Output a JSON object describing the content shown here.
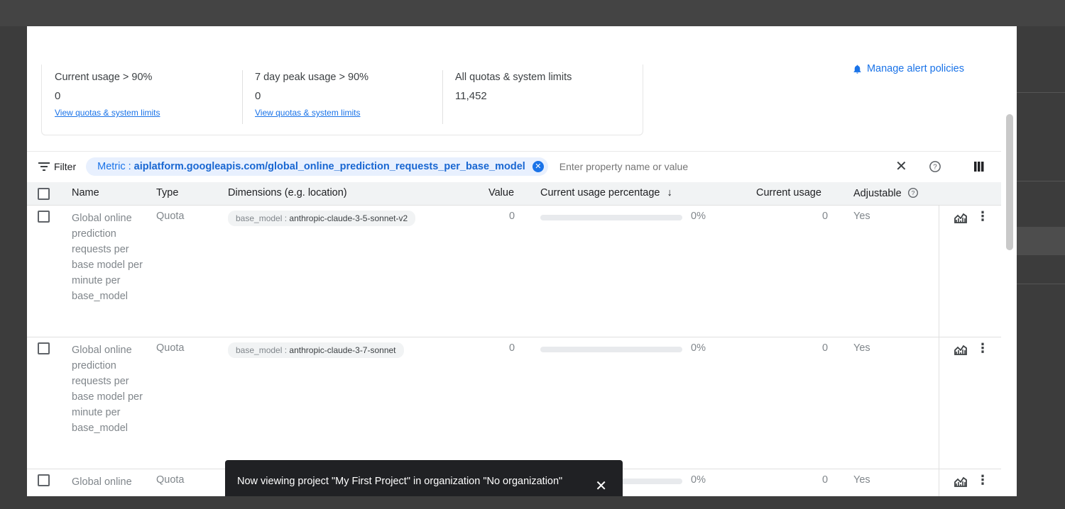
{
  "summary": {
    "stats": [
      {
        "label": "Current usage > 90%",
        "value": "0",
        "link": "View quotas & system limits"
      },
      {
        "label": "7 day peak usage > 90%",
        "value": "0",
        "link": "View quotas & system limits"
      },
      {
        "label": "All quotas & system limits",
        "value": "11,452"
      }
    ],
    "alert_link": "Manage alert policies"
  },
  "filter": {
    "label": "Filter",
    "chip_key": "Metric",
    "chip_sep": ":",
    "chip_value": "aiplatform.googleapis.com/global_online_prediction_requests_per_base_model",
    "placeholder": "Enter property name or value"
  },
  "table": {
    "headers": {
      "name": "Name",
      "type": "Type",
      "dimensions": "Dimensions (e.g. location)",
      "value": "Value",
      "usage_pct": "Current usage percentage",
      "current_usage": "Current usage",
      "adjustable": "Adjustable"
    },
    "rows": [
      {
        "name": "Global online prediction requests per base model per minute per base_model",
        "type": "Quota",
        "dim_key": "base_model",
        "dim_sep": ":",
        "dim_value": "anthropic-claude-3-5-sonnet-v2",
        "value": "0",
        "usage_pct": "0%",
        "usage_fraction": 0,
        "current_usage": "0",
        "adjustable": "Yes"
      },
      {
        "name": "Global online prediction requests per base model per minute per base_model",
        "type": "Quota",
        "dim_key": "base_model",
        "dim_sep": ":",
        "dim_value": "anthropic-claude-3-7-sonnet",
        "value": "0",
        "usage_pct": "0%",
        "usage_fraction": 0,
        "current_usage": "0",
        "adjustable": "Yes"
      },
      {
        "name": "Global online",
        "type": "Quota",
        "usage_pct": "0%",
        "usage_fraction": 0,
        "current_usage": "0",
        "adjustable": "Yes"
      }
    ]
  },
  "toast": {
    "message": "Now viewing project \"My First Project\" in organization \"No organization\""
  },
  "colors": {
    "accent": "#1a73e8",
    "toast_bg": "#202124",
    "header_bg": "#f1f3f4"
  }
}
